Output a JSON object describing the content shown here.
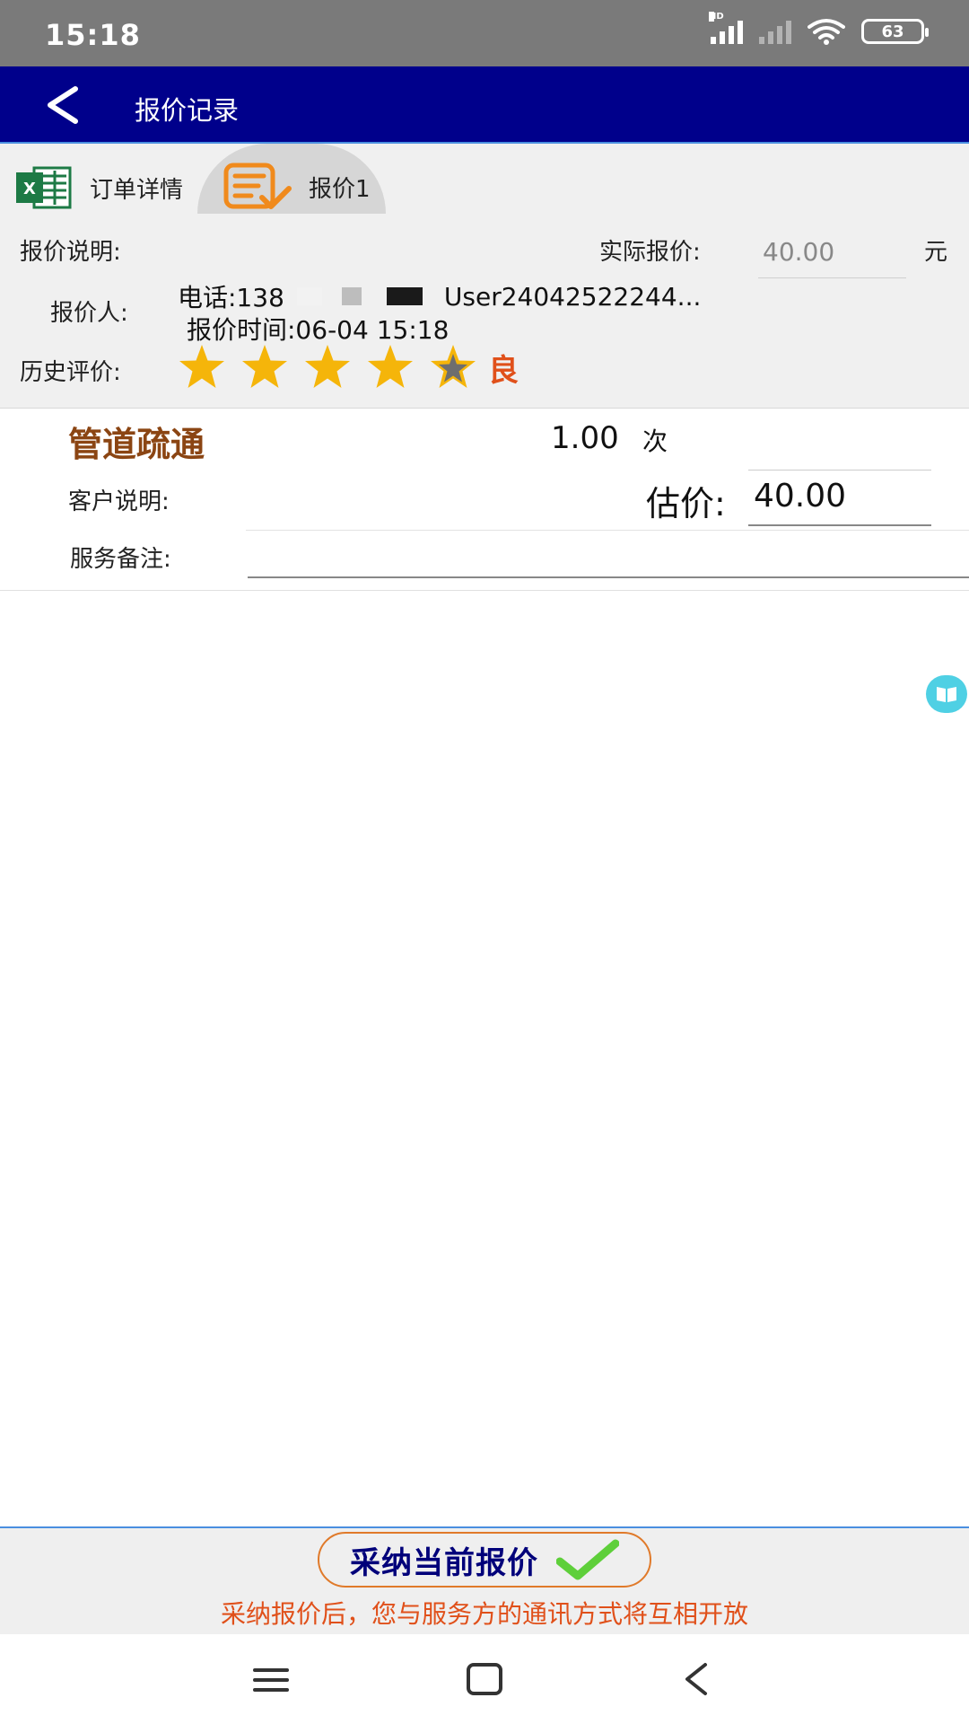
{
  "status_bar": {
    "time": "15:18",
    "network_label": "HD",
    "battery": "63",
    "icons": [
      "signal-icon",
      "signal-weak-icon",
      "wifi-icon",
      "battery-icon"
    ]
  },
  "app_bar": {
    "back_icon": "back-arrow-icon",
    "title": "报价记录"
  },
  "tabs": [
    {
      "label": "订单详情",
      "icon": "excel-icon"
    },
    {
      "label": "报价1",
      "icon": "quote-check-icon"
    }
  ],
  "quote_info": {
    "description_label": "报价说明:",
    "actual_price_label": "实际报价:",
    "actual_price_value": "40.00",
    "currency_unit": "元",
    "quoter_label": "报价人:",
    "phone_prefix": "电话:138",
    "username": "User24042522244...",
    "quote_time": "报价时间:06-04 15:18",
    "history_rating_label": "历史评价:",
    "rating_stars": 4,
    "rating_max": 5,
    "rating_text": "良"
  },
  "service": {
    "name": "管道疏通",
    "quantity": "1.00",
    "quantity_unit": "次",
    "customer_note_label": "客户说明:",
    "estimate_label": "估价:",
    "estimate_value": "40.00",
    "remark_label": "服务备注:"
  },
  "action": {
    "adopt_label": "采纳当前报价",
    "adopt_note": "采纳报价后，您与服务方的通讯方式将互相开放"
  },
  "colors": {
    "status_bar": "#7a7a7a",
    "app_bar": "#00008b",
    "service_name": "#8b4513",
    "accent_orange": "#e0501a",
    "star": "#f5b50a"
  }
}
